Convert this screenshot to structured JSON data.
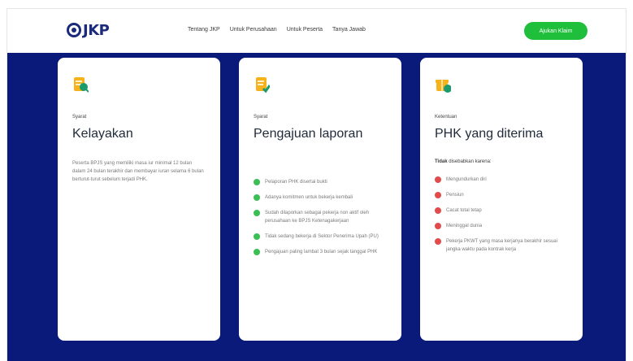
{
  "brand": {
    "logo_text": "JKP",
    "colors": {
      "brand_navy": "#1b2a7a",
      "accent_green": "#1fbf3b",
      "hero_bg": "#0a1a7a",
      "check_green": "#3bbf55",
      "cross_red": "#e14b4b"
    }
  },
  "nav": {
    "links": [
      "Tentang JKP",
      "Untuk Perusahaan",
      "Untuk Peserta",
      "Tanya Jawab"
    ],
    "cta_label": "Ajukan Klaim"
  },
  "cards": [
    {
      "kicker": "Syarat",
      "title": "Kelayakan",
      "icon": "document-search-icon",
      "body": "Peserta BPJS yang memiliki masa iur minimal 12 bulan dalam 24 bulan terakhir dan membayar iuran selama 6 bulan berturut-turut sebelum terjadi PHK."
    },
    {
      "kicker": "Syarat",
      "title": "Pengajuan laporan",
      "icon": "document-check-icon",
      "items": [
        "Pelaporan PHK disertai bukti",
        "Adanya komitmen untuk bekerja kembali",
        "Sudah dilaporkan sebagai pekerja non aktif oleh perusahaan ke BPJS Ketenagakerjaan",
        "Tidak sedang bekerja di Sektor Penerima Upah (PU)",
        "Pengajuan paling lambat 3 bulan sejak tanggal PHK"
      ]
    },
    {
      "kicker": "Ketentuan",
      "title": "PHK yang diterima",
      "icon": "gift-box-icon",
      "note_bold": "Tidak",
      "note_rest": " disebabkan karena:",
      "items": [
        "Mengundurkan diri",
        "Pensiun",
        "Cacat total tetap",
        "Meninggal dunia",
        "Pekerja PKWT yang masa kerjanya berakhir sesuai jangka waktu pada kontrak kerja"
      ]
    }
  ]
}
